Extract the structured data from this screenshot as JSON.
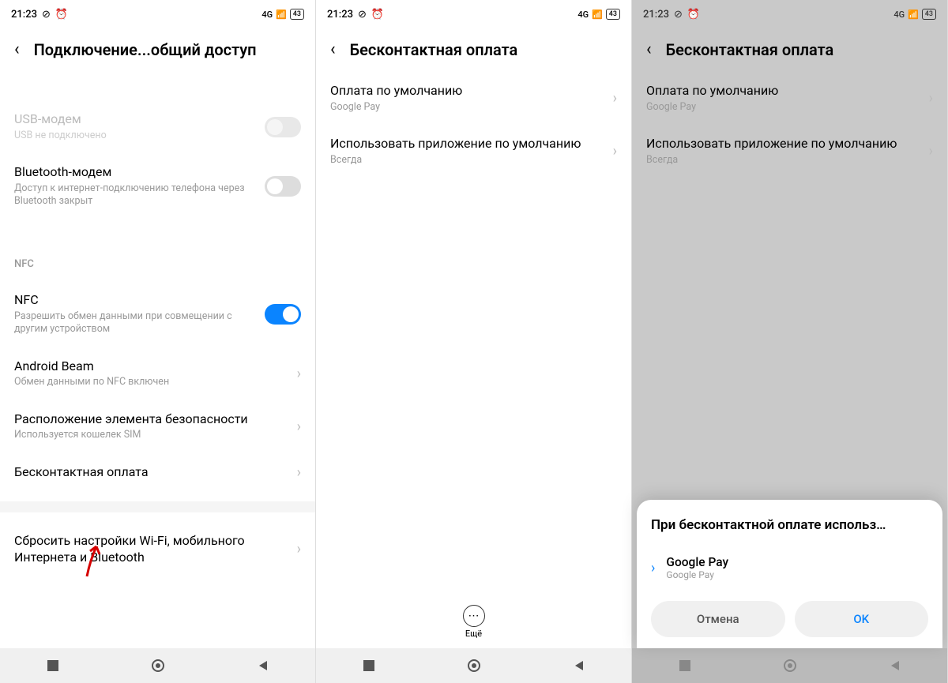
{
  "status": {
    "time": "21:23",
    "battery": "43",
    "network": "4G"
  },
  "screen1": {
    "title": "Подключение...общий доступ",
    "items": {
      "usb": {
        "title": "USB-модем",
        "sub": "USB не подключено"
      },
      "bt": {
        "title": "Bluetooth-модем",
        "sub": "Доступ к интернет-подключению телефона через Bluetooth закрыт"
      },
      "nfc_header": "NFC",
      "nfc": {
        "title": "NFC",
        "sub": "Разрешить обмен данными при совмещении с другим устройством"
      },
      "beam": {
        "title": "Android Beam",
        "sub": "Обмен данными по NFC включен"
      },
      "secure": {
        "title": "Расположение элемента безопасности",
        "sub": "Используется кошелек SIM"
      },
      "contactless": {
        "title": "Бесконтактная оплата"
      },
      "reset": {
        "title": "Сбросить настройки Wi-Fi, мобильного Интернета и Bluetooth"
      }
    }
  },
  "screen2": {
    "title": "Бесконтактная оплата",
    "items": {
      "default_pay": {
        "title": "Оплата по умолчанию",
        "sub": "Google Pay"
      },
      "use_default": {
        "title": "Использовать приложение по умолчанию",
        "sub": "Всегда"
      }
    },
    "more": "Ещё"
  },
  "screen3": {
    "title": "Бесконтактная оплата",
    "items": {
      "default_pay": {
        "title": "Оплата по умолчанию",
        "sub": "Google Pay"
      },
      "use_default": {
        "title": "Использовать приложение по умолчанию",
        "sub": "Всегда"
      }
    },
    "sheet": {
      "title": "При бесконтактной оплате использ…",
      "option": {
        "title": "Google Pay",
        "sub": "Google Pay"
      },
      "cancel": "Отмена",
      "ok": "OK"
    }
  }
}
